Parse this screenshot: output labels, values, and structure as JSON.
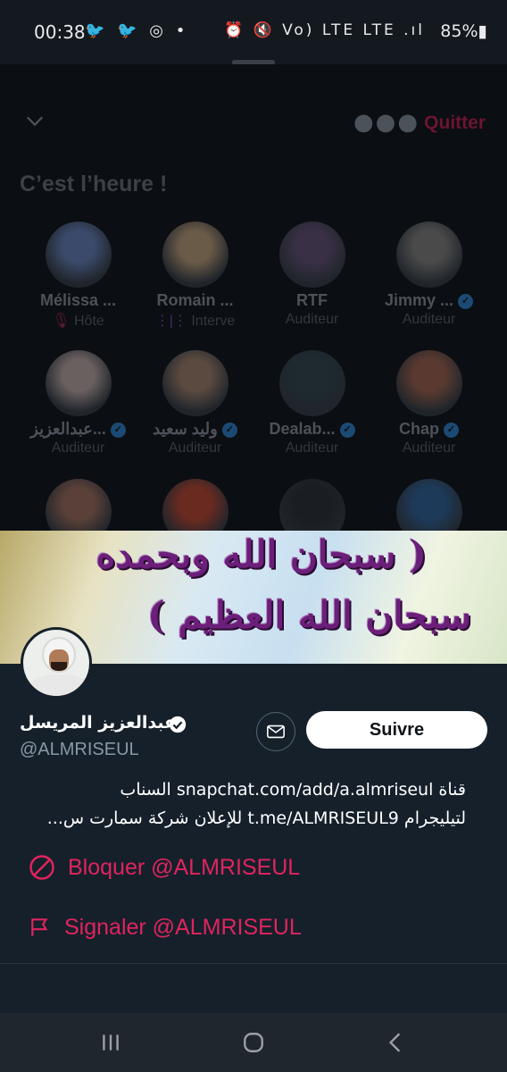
{
  "status": {
    "time": "00:38",
    "left_icons": "🐦 🐦 ◎ •",
    "right_icons": "⏰ 🔇 Vo) LTE LTE .ıl",
    "battery": "85%"
  },
  "space": {
    "quit_label": "Quitter",
    "title": "C’est l’heure !",
    "participants": [
      {
        "name": "Mélissa ...",
        "role": "Hôte",
        "role_icon": "mic-off-icon",
        "verified": false,
        "color": "#3b4a6a"
      },
      {
        "name": "Romain ...",
        "role": "Interve",
        "role_icon": "speaking-icon",
        "verified": false,
        "color": "#6a5a48"
      },
      {
        "name": "RTF",
        "role": "Auditeur",
        "verified": false,
        "color": "#3a3046"
      },
      {
        "name": "Jimmy ...",
        "role": "Auditeur",
        "verified": true,
        "color": "#4a4a4a"
      },
      {
        "name": "عبدالعزيز...",
        "role": "Auditeur",
        "verified": true,
        "color": "#6a6060"
      },
      {
        "name": "وليد سعيد",
        "role": "Auditeur",
        "verified": true,
        "color": "#5a4a40"
      },
      {
        "name": "Dealab...",
        "role": "Auditeur",
        "verified": true,
        "color": "#1e2a30"
      },
      {
        "name": "Chap",
        "role": "Auditeur",
        "verified": true,
        "color": "#5a3a30"
      },
      {
        "name": "",
        "role": "",
        "verified": false,
        "color": "#5a4038"
      },
      {
        "name": "",
        "role": "",
        "verified": false,
        "color": "#6a2a20"
      },
      {
        "name": "",
        "role": "",
        "verified": false,
        "color": "#1a1d22"
      },
      {
        "name": "",
        "role": "",
        "verified": false,
        "color": "#1e3a5a"
      }
    ]
  },
  "profile": {
    "banner_line1": "( سبحان الله وبحمده",
    "banner_line2": "سبحان الله العظيم )",
    "name": "عبدالعزيز المريسل",
    "handle": "@ALMRISEUL",
    "follow_label": "Suivre",
    "bio_line1": "قناة snapchat.com/add/a.almriseul السناب",
    "bio_line2": "لتيليجرام t.me/ALMRISEUL9 للإعلان شركة سمارت س...",
    "block_label": "Bloquer @ALMRISEUL",
    "report_label": "Signaler @ALMRISEUL"
  },
  "colors": {
    "accent_red": "#e0245e",
    "verified_blue": "#1d9bf0",
    "card_bg": "#15202b"
  }
}
